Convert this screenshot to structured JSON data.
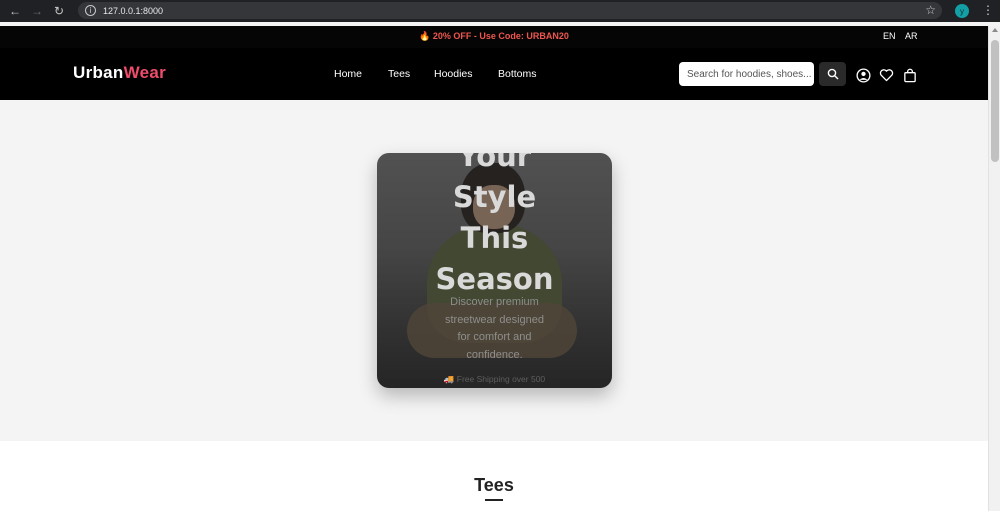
{
  "browser": {
    "url": "127.0.0.1:8000",
    "profile_initial": "y"
  },
  "promo": {
    "text": "🔥 20% OFF - Use Code: URBAN20",
    "lang_en": "EN",
    "lang_ar": "AR"
  },
  "header": {
    "logo_part1": "Urban",
    "logo_part2": "Wear",
    "nav": [
      "Home",
      "Tees",
      "Hoodies",
      "Bottoms"
    ],
    "search_placeholder": "Search for hoodies, shoes..."
  },
  "hero": {
    "title_line0": "Your",
    "title_line1": "Style",
    "title_line2": "This",
    "title_line3": "Season",
    "subtitle": "Discover premium streetwear designed for comfort and confidence.",
    "shipping": "🚚 Free Shipping over 500"
  },
  "section": {
    "title": "Tees"
  },
  "colors": {
    "brand_accent": "#ef4b6b",
    "promo_text": "#f0564f",
    "header_bg": "#000000"
  }
}
